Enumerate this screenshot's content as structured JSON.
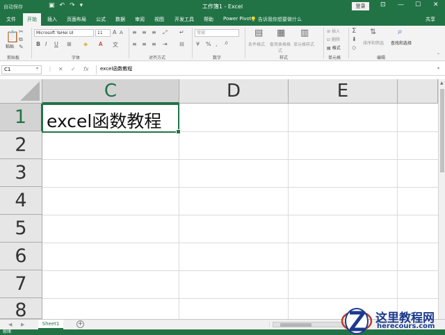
{
  "titlebar": {
    "autosave": "自动保存",
    "title": "工作簿1 - Excel",
    "login": "登录"
  },
  "tabs": [
    "文件",
    "开始",
    "插入",
    "页面布局",
    "公式",
    "数据",
    "审阅",
    "视图",
    "开发工具",
    "帮助",
    "Power Pivot"
  ],
  "tell_me": "告诉我你想要做什么",
  "share": "共享",
  "ribbon": {
    "paste": "粘贴",
    "font_name": "Microsoft YaHei UI",
    "font_size": "11",
    "number_format": "常规",
    "groups": [
      "剪贴板",
      "字体",
      "对齐方式",
      "数字",
      "样式",
      "单元格",
      "编辑"
    ],
    "styles": [
      "条件格式",
      "套用表格格式",
      "单元格样式"
    ],
    "cells": [
      "插入",
      "删除",
      "格式"
    ],
    "editing": [
      "排序和筛选",
      "查找和选择"
    ]
  },
  "formula_bar": {
    "name_box": "C1",
    "formula": "excel函数教程"
  },
  "columns": [
    "C",
    "D",
    "E"
  ],
  "rows": [
    "1",
    "2",
    "3",
    "4",
    "5",
    "6",
    "7",
    "8"
  ],
  "cell_c1": "excel函数教程",
  "sheet_tab": "Sheet1",
  "status_text": "就绪",
  "watermark": {
    "name": "这里教程网",
    "url": "herecours.com"
  },
  "colors": {
    "accent": "#217346",
    "watermark": "#1b3a8c"
  }
}
